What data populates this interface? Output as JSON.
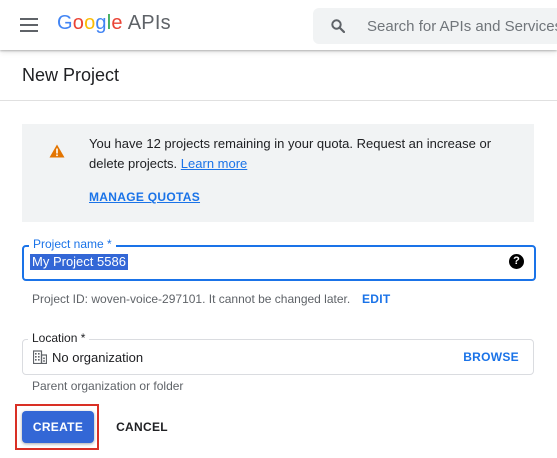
{
  "header": {
    "logo": {
      "g1": "G",
      "g2": "o",
      "g3": "o",
      "g4": "g",
      "g5": "l",
      "g6": "e",
      "suffix": "APIs"
    },
    "search": {
      "placeholder": "Search for APIs and Services"
    },
    "icons": {
      "menu": "menu-icon",
      "search": "search-icon"
    }
  },
  "page": {
    "title": "New Project"
  },
  "notice": {
    "text": "You have 12 projects remaining in your quota. Request an increase or delete projects.",
    "link_label": "Learn more",
    "manage_label": "MANAGE QUOTAS",
    "icon": "warning-icon",
    "icon_color": "#e37400"
  },
  "form": {
    "project_name": {
      "label": "Project name *",
      "value": "My Project 5586",
      "help_icon": "help-icon"
    },
    "project_id": {
      "text": "Project ID: woven-voice-297101. It cannot be changed later.",
      "edit_label": "EDIT"
    },
    "location": {
      "label": "Location *",
      "value": "No organization",
      "browse_label": "BROWSE",
      "helper": "Parent organization or folder",
      "icon": "building-icon"
    }
  },
  "actions": {
    "create_label": "CREATE",
    "cancel_label": "CANCEL"
  },
  "colors": {
    "accent": "#1a73e8",
    "primary_button": "#3367d6",
    "highlight": "#d93025"
  }
}
